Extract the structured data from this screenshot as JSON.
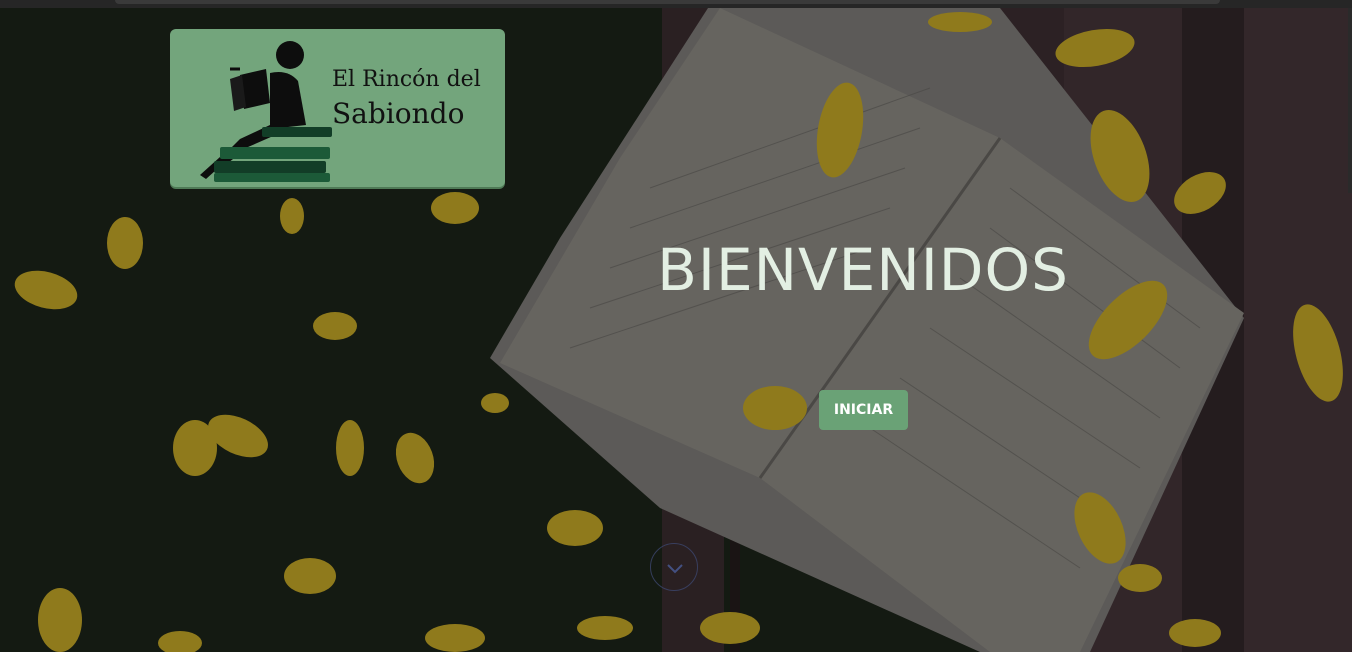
{
  "logo": {
    "line1": "El Rincón del",
    "line2": "Sabiondo",
    "icon": "reading-person-on-books-icon"
  },
  "hero": {
    "title": "BIENVENIDOS",
    "start_button_label": "INICIAR",
    "scroll_icon": "chevron-down-icon",
    "background_image": "open-book-with-autumn-leaves-photo"
  },
  "colors": {
    "logo_background": "#73a57c",
    "button_background": "#6aa276",
    "title_text": "#e3efe3",
    "overlay": "#12160f"
  }
}
